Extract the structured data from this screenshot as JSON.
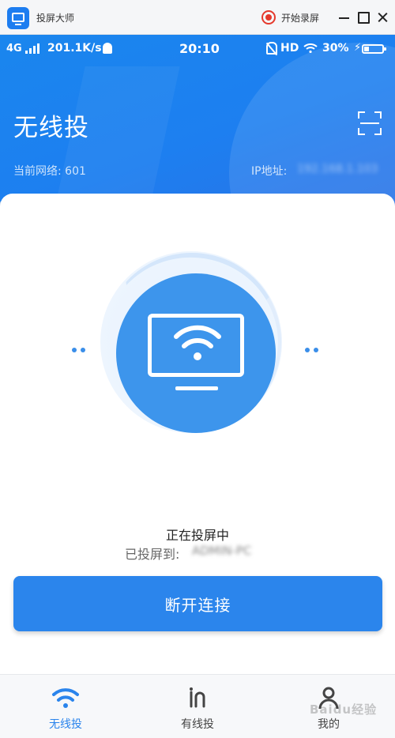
{
  "titlebar": {
    "app_title": "投屏大师",
    "record_label": "开始录屏",
    "record_color": "#e5392c"
  },
  "status_bar": {
    "network": "4G",
    "speed": "201.1K/s",
    "time": "20:10",
    "hd": "HD",
    "battery_percent": "30%",
    "battery_level": 0.3,
    "icons": [
      "signal-bars-icon",
      "notification-bell-icon",
      "mute-icon",
      "wifi-icon",
      "charging-bolt-icon",
      "battery-icon"
    ]
  },
  "header": {
    "title": "无线投",
    "network_info": "当前网络: 601",
    "ip_label": "IP地址:",
    "ip_value": "192.168.1.103",
    "scan_icon": "scan-icon",
    "accent": "#1d7ff0"
  },
  "cast": {
    "status": "正在投屏中",
    "target_label": "已投屏到:",
    "target_device": "ADMIN-PC",
    "icon": "tv-wifi-icon"
  },
  "actions": {
    "disconnect_label": "断开连接",
    "button_color": "#2b85ec"
  },
  "bottom_nav": {
    "items": [
      {
        "label": "无线投",
        "icon": "wifi-icon",
        "active": true
      },
      {
        "label": "有线投",
        "icon": "cable-icon",
        "active": false
      },
      {
        "label": "我的",
        "icon": "user-icon",
        "active": false
      }
    ],
    "active_color": "#2a84ec"
  },
  "watermark": {
    "text": "Baidu经验"
  }
}
